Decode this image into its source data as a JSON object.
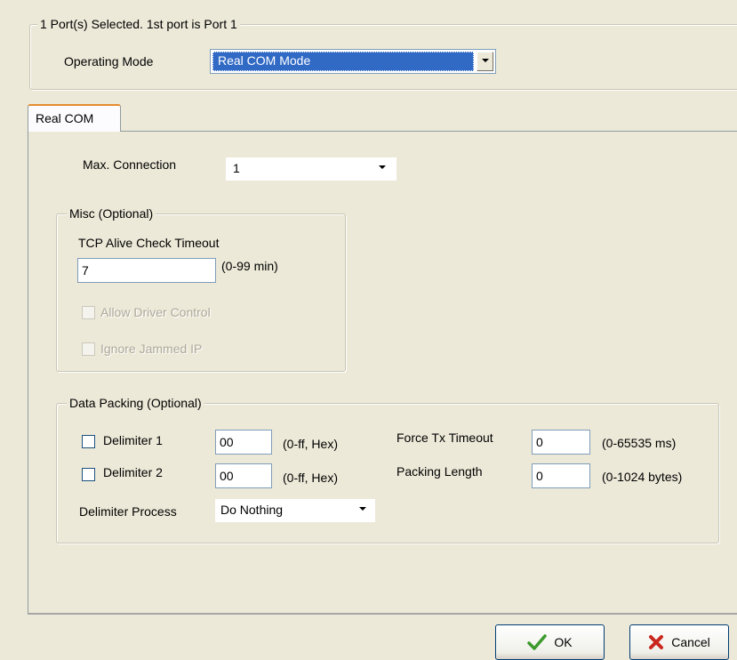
{
  "header": {
    "ports_selected": "1 Port(s) Selected. 1st port is Port 1",
    "operating_mode_label": "Operating Mode",
    "operating_mode_value": "Real COM Mode"
  },
  "tab": {
    "label": "Real COM"
  },
  "max_connection": {
    "label": "Max. Connection",
    "value": "1"
  },
  "misc": {
    "legend": "Misc (Optional)",
    "tcp_label": "TCP Alive Check Timeout",
    "tcp_value": "7",
    "tcp_range": "(0-99 min)",
    "allow_driver_control": "Allow Driver Control",
    "ignore_jammed_ip": "Ignore Jammed IP"
  },
  "data_packing": {
    "legend": "Data Packing (Optional)",
    "delimiter1_label": "Delimiter 1",
    "delimiter1_value": "00",
    "delimiter1_range": "(0-ff, Hex)",
    "delimiter2_label": "Delimiter 2",
    "delimiter2_value": "00",
    "delimiter2_range": "(0-ff, Hex)",
    "process_label": "Delimiter Process",
    "process_value": "Do Nothing",
    "force_tx_label": "Force Tx Timeout",
    "force_tx_value": "0",
    "force_tx_range": "(0-65535 ms)",
    "packing_length_label": "Packing Length",
    "packing_length_value": "0",
    "packing_length_range": "(0-1024 bytes)"
  },
  "buttons": {
    "ok": "OK",
    "cancel": "Cancel"
  },
  "icons": {
    "ok": "checkmark-icon",
    "cancel": "x-icon"
  },
  "colors": {
    "selection": "#316ac5",
    "window": "#ece9d8",
    "ok_check": "#3c9a2c",
    "cancel_x": "#c8281e"
  }
}
